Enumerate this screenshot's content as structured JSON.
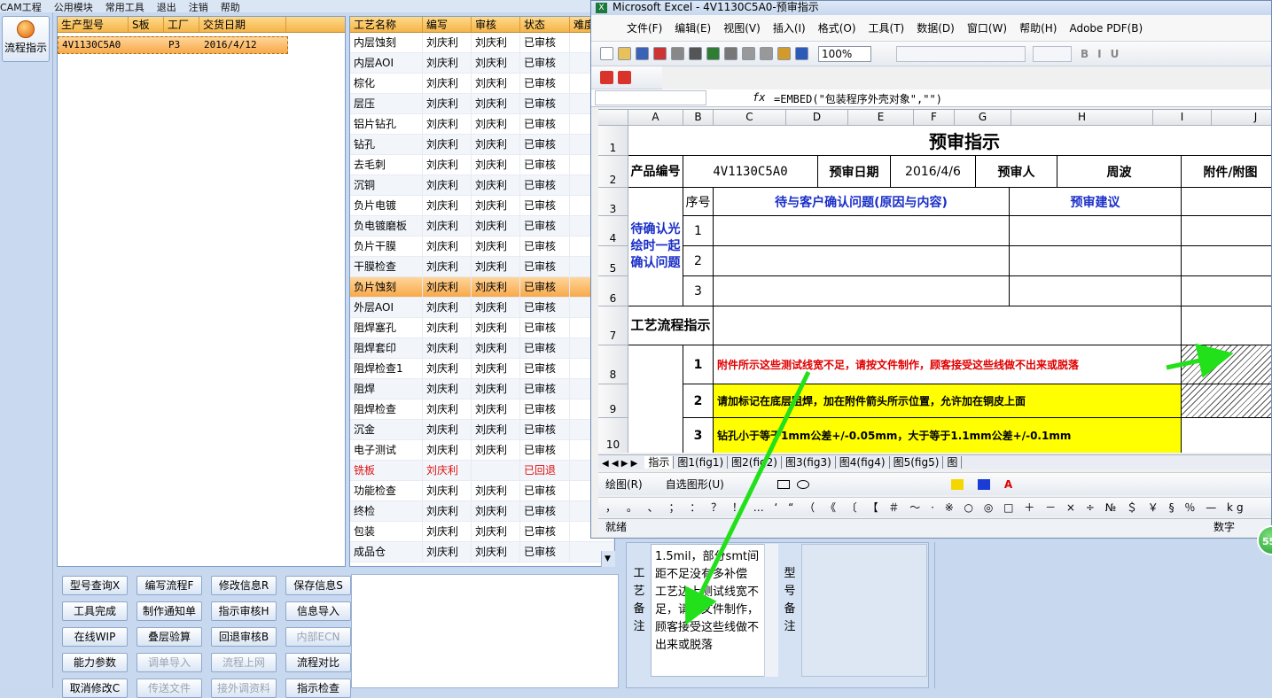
{
  "topbar": {
    "items": [
      "CAM工程",
      "公用模块",
      "常用工具",
      "退出",
      "注销",
      "帮助"
    ]
  },
  "sidebar": {
    "flow_label": "流程指示"
  },
  "product_table": {
    "headers": [
      "生产型号",
      "S板",
      "工厂",
      "交货日期"
    ],
    "rows": [
      [
        "4V1130C5A0",
        "",
        "P3",
        "2016/4/12"
      ]
    ]
  },
  "process_table": {
    "headers": [
      "工艺名称",
      "编写",
      "审核",
      "状态",
      "难度"
    ],
    "rows": [
      [
        "内层蚀刻",
        "刘庆利",
        "刘庆利",
        "已审核"
      ],
      [
        "内层AOI",
        "刘庆利",
        "刘庆利",
        "已审核"
      ],
      [
        "棕化",
        "刘庆利",
        "刘庆利",
        "已审核"
      ],
      [
        "层压",
        "刘庆利",
        "刘庆利",
        "已审核"
      ],
      [
        "铝片钻孔",
        "刘庆利",
        "刘庆利",
        "已审核"
      ],
      [
        "钻孔",
        "刘庆利",
        "刘庆利",
        "已审核"
      ],
      [
        "去毛刺",
        "刘庆利",
        "刘庆利",
        "已审核"
      ],
      [
        "沉铜",
        "刘庆利",
        "刘庆利",
        "已审核"
      ],
      [
        "负片电镀",
        "刘庆利",
        "刘庆利",
        "已审核"
      ],
      [
        "负电镀磨板",
        "刘庆利",
        "刘庆利",
        "已审核"
      ],
      [
        "负片干膜",
        "刘庆利",
        "刘庆利",
        "已审核"
      ],
      [
        "干膜检查",
        "刘庆利",
        "刘庆利",
        "已审核"
      ],
      [
        "负片蚀刻",
        "刘庆利",
        "刘庆利",
        "已审核"
      ],
      [
        "外层AOI",
        "刘庆利",
        "刘庆利",
        "已审核"
      ],
      [
        "阻焊塞孔",
        "刘庆利",
        "刘庆利",
        "已审核"
      ],
      [
        "阻焊套印",
        "刘庆利",
        "刘庆利",
        "已审核"
      ],
      [
        "阻焊检查1",
        "刘庆利",
        "刘庆利",
        "已审核"
      ],
      [
        "阻焊",
        "刘庆利",
        "刘庆利",
        "已审核"
      ],
      [
        "阻焊检查",
        "刘庆利",
        "刘庆利",
        "已审核"
      ],
      [
        "沉金",
        "刘庆利",
        "刘庆利",
        "已审核"
      ],
      [
        "电子测试",
        "刘庆利",
        "刘庆利",
        "已审核"
      ],
      [
        "铣板",
        "刘庆利",
        "",
        "已回退"
      ],
      [
        "功能检查",
        "刘庆利",
        "刘庆利",
        "已审核"
      ],
      [
        "终检",
        "刘庆利",
        "刘庆利",
        "已审核"
      ],
      [
        "包装",
        "刘庆利",
        "刘庆利",
        "已审核"
      ],
      [
        "成品仓",
        "刘庆利",
        "刘庆利",
        "已审核"
      ]
    ]
  },
  "buttons": [
    [
      "型号查询X",
      "编写流程F",
      "修改信息R",
      "保存信息S"
    ],
    [
      "工具完成",
      "制作通知单",
      "指示审核H",
      "信息导入"
    ],
    [
      "在线WIP",
      "叠层验算",
      "回退审核B",
      "内部ECN"
    ],
    [
      "能力参数",
      "调单导入",
      "流程上网",
      "流程对比"
    ],
    [
      "取消修改C",
      "传送文件",
      "接外调资料",
      "指示检查"
    ]
  ],
  "remarks": {
    "label1": "工艺备注",
    "label2": "型号备注",
    "memo_text": "1.5mil，部分smt间距不足没有多补偿 工艺边上测试线宽不足，请按文件制作，顾客接受这些线做不出来或脱落"
  },
  "excel": {
    "title": "Microsoft Excel - 4V1130C5A0-预审指示",
    "menus": [
      "文件(F)",
      "编辑(E)",
      "视图(V)",
      "插入(I)",
      "格式(O)",
      "工具(T)",
      "数据(D)",
      "窗口(W)",
      "帮助(H)",
      "Adobe PDF(B)"
    ],
    "zoom": "100%",
    "formula": "=EMBED(\"包装程序外壳对象\",\"\")",
    "fx": "fx",
    "columns": [
      "A",
      "B",
      "C",
      "D",
      "E",
      "F",
      "G",
      "H",
      "I",
      "J"
    ],
    "rows": [
      "1",
      "2",
      "3",
      "4",
      "5",
      "6",
      "7",
      "8",
      "9",
      "10"
    ],
    "sheet_title": "预审指示",
    "product_no_label": "产品编号",
    "product_no": "4V1130C5A0",
    "review_date_label": "预审日期",
    "review_date": "2016/4/6",
    "reviewer_label": "预审人",
    "reviewer": "周波",
    "attach_label": "附件/附图",
    "seq_label": "序号",
    "issue_label": "待与客户确认问题(原因与内容)",
    "advice_label": "预审建议",
    "confirm_label": "待确认光绘时一起确认问题",
    "flow_label": "工艺流程指示",
    "seq": [
      "1",
      "2",
      "3"
    ],
    "instr": [
      {
        "n": "1",
        "text": "附件所示这些测试线宽不足，请按文件制作，顾客接受这些线做不出来或脱落"
      },
      {
        "n": "2",
        "text": "请加标记在底层阻焊，加在附件箭头所示位置，允许加在铜皮上面"
      },
      {
        "n": "3",
        "text": "钻孔小于等于1mm公差+/-0.05mm，大于等于1.1mm公差+/-0.1mm"
      }
    ],
    "sheets": [
      "指示",
      "图1(fig1)",
      "图2(fig2)",
      "图3(fig3)",
      "图4(fig4)",
      "图5(fig5)",
      "图"
    ],
    "draw_label": "绘图(R)",
    "autoshape_label": "自选图形(U)",
    "symbols": "， 。 、 ； ： ？ ！ … ‘ “ （ 《 〔 【 ＃ ～ · ※ ○ ◎ □ ＋ － × ÷ № ＄ ￥ § ％ — kg",
    "status": "就绪",
    "numlock": "数字"
  },
  "badge": "55",
  "colors": {
    "accent": "#f8a94a",
    "green_arrow": "#22e01a",
    "instr_red": "#e00000",
    "yellow": "#ffff00"
  }
}
